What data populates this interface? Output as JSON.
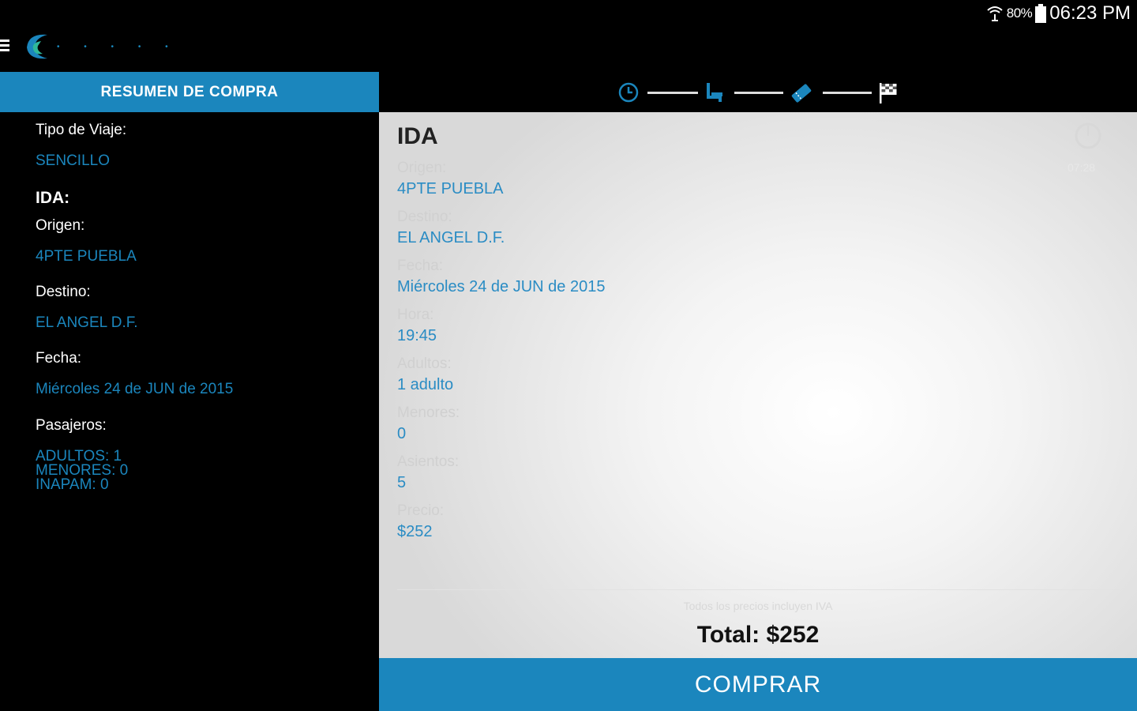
{
  "status_bar": {
    "battery": "80%",
    "time": "06:23 PM"
  },
  "app": {
    "logo_text": "• • • • •"
  },
  "summary": {
    "header": "RESUMEN DE COMPRA",
    "trip_type_label": "Tipo de Viaje:",
    "trip_type_value": "SENCILLO",
    "ida_heading": "IDA:",
    "origin_label": "Origen:",
    "origin_value": "4PTE PUEBLA",
    "destination_label": "Destino:",
    "destination_value": "EL ANGEL D.F.",
    "date_label": "Fecha:",
    "date_value": "Miércoles 24 de JUN de 2015",
    "passengers_label": "Pasajeros:",
    "adults": "ADULTOS: 1",
    "minors": "MENORES: 0",
    "inapam": "INAPAM: 0"
  },
  "stepper": {
    "steps": [
      "clock-icon",
      "seat-icon",
      "ticket-icon",
      "flag-icon"
    ],
    "active_color": "#1b86bd"
  },
  "detail": {
    "title": "IDA",
    "timer": "07:28",
    "origin_label": "Origen:",
    "origin_value": "4PTE PUEBLA",
    "destination_label": "Destino:",
    "destination_value": "EL ANGEL D.F.",
    "date_label": "Fecha:",
    "date_value": "Miércoles 24 de JUN de 2015",
    "hour_label": "Hora:",
    "hour_value": "19:45",
    "adults_label": "Adultos:",
    "adults_value": "1 adulto",
    "minors_label": "Menores:",
    "minors_value": "0",
    "seats_label": "Asientos:",
    "seats_value": "5",
    "price_label": "Precio:",
    "price_value": "$252",
    "iva_note": "Todos los precios incluyen IVA",
    "total": "Total: $252"
  },
  "buy_button": "COMPRAR",
  "colors": {
    "accent": "#1b86bd",
    "background": "#000000"
  }
}
